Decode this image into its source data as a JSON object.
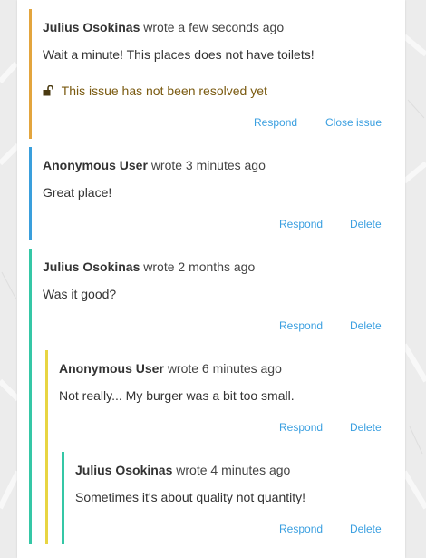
{
  "colors": {
    "unresolved": "#e3a53e",
    "anonymous": "#3a9fdc",
    "user": "#35c7a6",
    "nested_anonymous": "#e8d542",
    "link": "#3a9fe0"
  },
  "comments": [
    {
      "author": "Julius Osokinas",
      "meta": "wrote a few seconds ago",
      "text": "Wait a minute! This places does not have toilets!",
      "status": "This issue has not been resolved yet",
      "actions": [
        "Respond",
        "Close issue"
      ]
    },
    {
      "author": "Anonymous User",
      "meta": "wrote 3 minutes ago",
      "text": "Great place!",
      "actions": [
        "Respond",
        "Delete"
      ]
    },
    {
      "author": "Julius Osokinas",
      "meta": "wrote 2 months ago",
      "text": "Was it good?",
      "actions": [
        "Respond",
        "Delete"
      ]
    },
    {
      "author": "Anonymous User",
      "meta": "wrote 6 minutes ago",
      "text": "Not really... My burger was a bit too small.",
      "actions": [
        "Respond",
        "Delete"
      ]
    },
    {
      "author": "Julius Osokinas",
      "meta": "wrote 4 minutes ago",
      "text": "Sometimes it's about quality not quantity!",
      "actions": [
        "Respond",
        "Delete"
      ]
    }
  ]
}
